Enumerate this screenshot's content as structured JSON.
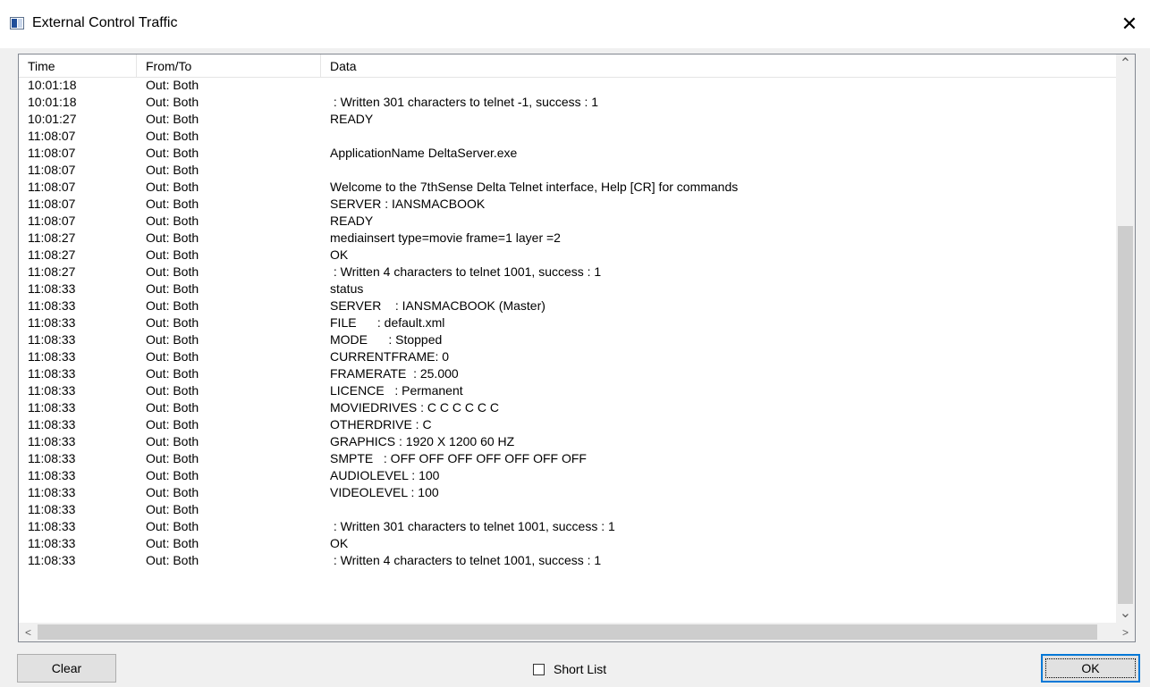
{
  "window": {
    "title": "External Control Traffic",
    "close_glyph": "✕"
  },
  "table": {
    "columns": [
      "Time",
      "From/To",
      "Data"
    ],
    "rows": [
      {
        "time": "10:01:18",
        "from": "Out: Both",
        "data": ""
      },
      {
        "time": "10:01:18",
        "from": "Out: Both",
        "data": " : Written 301 characters to telnet -1, success : 1"
      },
      {
        "time": "10:01:27",
        "from": "Out: Both",
        "data": "READY"
      },
      {
        "time": "11:08:07",
        "from": "Out: Both",
        "data": ""
      },
      {
        "time": "11:08:07",
        "from": "Out: Both",
        "data": "ApplicationName DeltaServer.exe"
      },
      {
        "time": "11:08:07",
        "from": "Out: Both",
        "data": ""
      },
      {
        "time": "11:08:07",
        "from": "Out: Both",
        "data": "Welcome to the 7thSense Delta Telnet interface, Help [CR] for commands"
      },
      {
        "time": "11:08:07",
        "from": "Out: Both",
        "data": "SERVER : IANSMACBOOK"
      },
      {
        "time": "11:08:07",
        "from": "Out: Both",
        "data": "READY"
      },
      {
        "time": "11:08:27",
        "from": "Out: Both",
        "data": "mediainsert type=movie frame=1 layer =2"
      },
      {
        "time": "11:08:27",
        "from": "Out: Both",
        "data": "OK"
      },
      {
        "time": "11:08:27",
        "from": "Out: Both",
        "data": " : Written 4 characters to telnet 1001, success : 1"
      },
      {
        "time": "11:08:33",
        "from": "Out: Both",
        "data": "status"
      },
      {
        "time": "11:08:33",
        "from": "Out: Both",
        "data": "SERVER    : IANSMACBOOK (Master)"
      },
      {
        "time": "11:08:33",
        "from": "Out: Both",
        "data": "FILE      : default.xml"
      },
      {
        "time": "11:08:33",
        "from": "Out: Both",
        "data": "MODE      : Stopped"
      },
      {
        "time": "11:08:33",
        "from": "Out: Both",
        "data": "CURRENTFRAME: 0"
      },
      {
        "time": "11:08:33",
        "from": "Out: Both",
        "data": "FRAMERATE  : 25.000"
      },
      {
        "time": "11:08:33",
        "from": "Out: Both",
        "data": "LICENCE   : Permanent"
      },
      {
        "time": "11:08:33",
        "from": "Out: Both",
        "data": "MOVIEDRIVES : C C C C C C"
      },
      {
        "time": "11:08:33",
        "from": "Out: Both",
        "data": "OTHERDRIVE : C"
      },
      {
        "time": "11:08:33",
        "from": "Out: Both",
        "data": "GRAPHICS : 1920 X 1200 60 HZ"
      },
      {
        "time": "11:08:33",
        "from": "Out: Both",
        "data": "SMPTE   : OFF OFF OFF OFF OFF OFF OFF"
      },
      {
        "time": "11:08:33",
        "from": "Out: Both",
        "data": "AUDIOLEVEL : 100"
      },
      {
        "time": "11:08:33",
        "from": "Out: Both",
        "data": "VIDEOLEVEL : 100"
      },
      {
        "time": "11:08:33",
        "from": "Out: Both",
        "data": ""
      },
      {
        "time": "11:08:33",
        "from": "Out: Both",
        "data": " : Written 301 characters to telnet 1001, success : 1"
      },
      {
        "time": "11:08:33",
        "from": "Out: Both",
        "data": "OK"
      },
      {
        "time": "11:08:33",
        "from": "Out: Both",
        "data": " : Written 4 characters to telnet 1001, success : 1"
      }
    ]
  },
  "scrollbars": {
    "up_glyph": "⌃",
    "down_glyph": "⌄",
    "left_glyph": "<",
    "right_glyph": ">"
  },
  "footer": {
    "clear_label": "Clear",
    "short_list_label": "Short List",
    "short_list_checked": false,
    "ok_label": "OK"
  }
}
